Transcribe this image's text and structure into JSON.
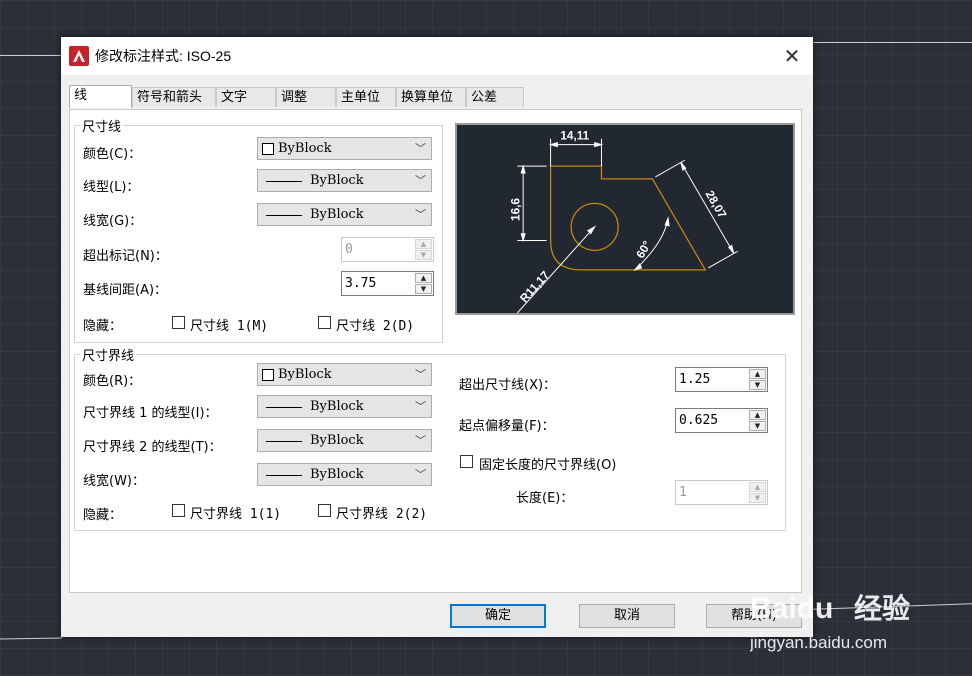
{
  "window": {
    "title": "修改标注样式: ISO-25",
    "close_glyph": "✕"
  },
  "tabs": [
    "线",
    "符号和箭头",
    "文字",
    "调整",
    "主单位",
    "换算单位",
    "公差"
  ],
  "dim_line": {
    "title": "尺寸线",
    "color_label": "颜色(C)：",
    "color_value": "ByBlock",
    "linetype_label": "线型(L)：",
    "linetype_value": "ByBlock",
    "lineweight_label": "线宽(G)：",
    "lineweight_value": "ByBlock",
    "extend_ticks_label": "超出标记(N)：",
    "extend_ticks_value": "0",
    "baseline_spacing_label": "基线间距(A)：",
    "baseline_spacing_value": "3.75",
    "suppress_label": "隐藏：",
    "suppress1": "尺寸线 1(M)",
    "suppress2": "尺寸线 2(D)"
  },
  "ext_line": {
    "title": "尺寸界线",
    "color_label": "颜色(R)：",
    "color_value": "ByBlock",
    "linetype1_label": "尺寸界线 1 的线型(I)：",
    "linetype1_value": "ByBlock",
    "linetype2_label": "尺寸界线 2 的线型(T)：",
    "linetype2_value": "ByBlock",
    "lineweight_label": "线宽(W)：",
    "lineweight_value": "ByBlock",
    "suppress_label": "隐藏：",
    "suppress1": "尺寸界线 1(1)",
    "suppress2": "尺寸界线 2(2)",
    "extend_beyond_label": "超出尺寸线(X)：",
    "extend_beyond_value": "1.25",
    "offset_label": "起点偏移量(F)：",
    "offset_value": "0.625",
    "fixed_length_label": "固定长度的尺寸界线(O)",
    "length_label": "长度(E)：",
    "length_value": "1"
  },
  "preview": {
    "dim_top": "14,11",
    "dim_left": "16,6",
    "dim_slant": "28,07",
    "angle": "60°",
    "radius": "R11,17"
  },
  "buttons": {
    "ok": "确定",
    "cancel": "取消",
    "help": "帮助(H)"
  },
  "watermark": {
    "brand": "Baidu",
    "product": "经验",
    "url": "jingyan.baidu.com"
  },
  "colors": {
    "accent": "#0078d7",
    "preview_bg": "#222832",
    "geometry": "#c8860a",
    "app_icon": "#c8232c"
  }
}
